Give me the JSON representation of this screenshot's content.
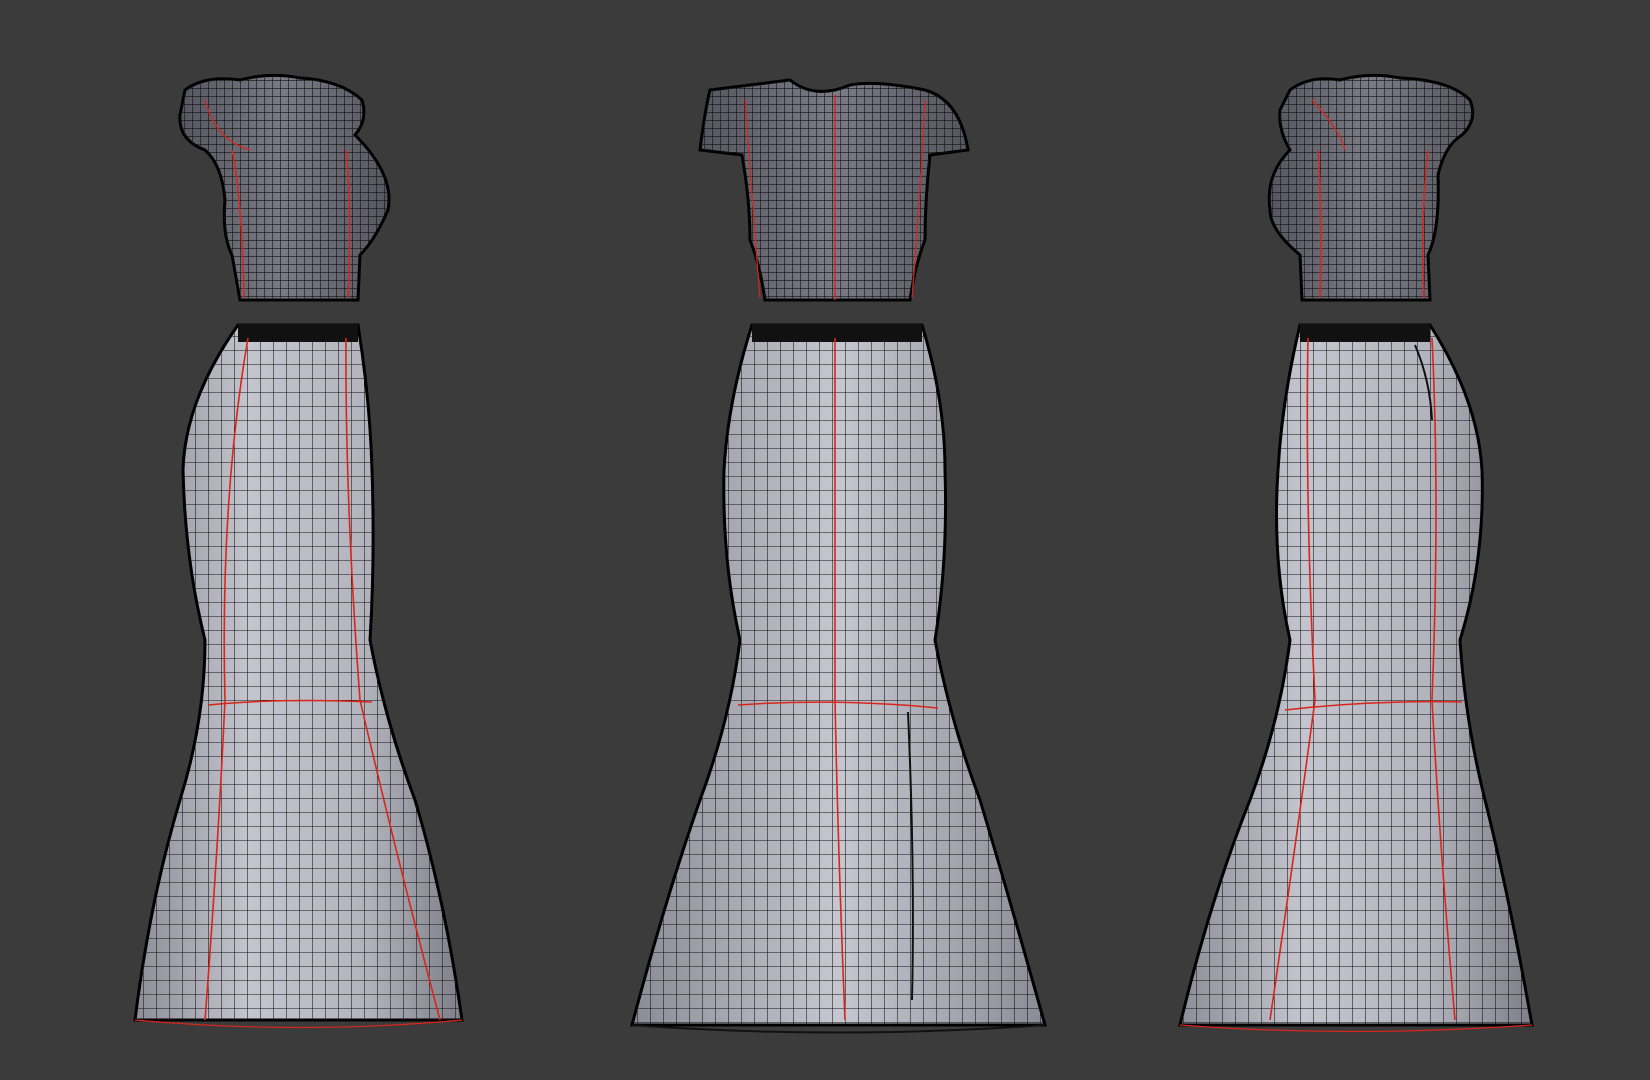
{
  "viewport": {
    "background_color": "#3b3b3b",
    "mesh_fill_color": "#b9bac4",
    "mesh_shadow_color": "#7d7e88",
    "wire_color": "#111111",
    "seam_color": "#d8261c"
  },
  "models": [
    {
      "view": "side-left",
      "parts": [
        "top",
        "skirt"
      ]
    },
    {
      "view": "front",
      "parts": [
        "top",
        "skirt"
      ]
    },
    {
      "view": "side-right",
      "parts": [
        "top",
        "skirt"
      ]
    }
  ]
}
